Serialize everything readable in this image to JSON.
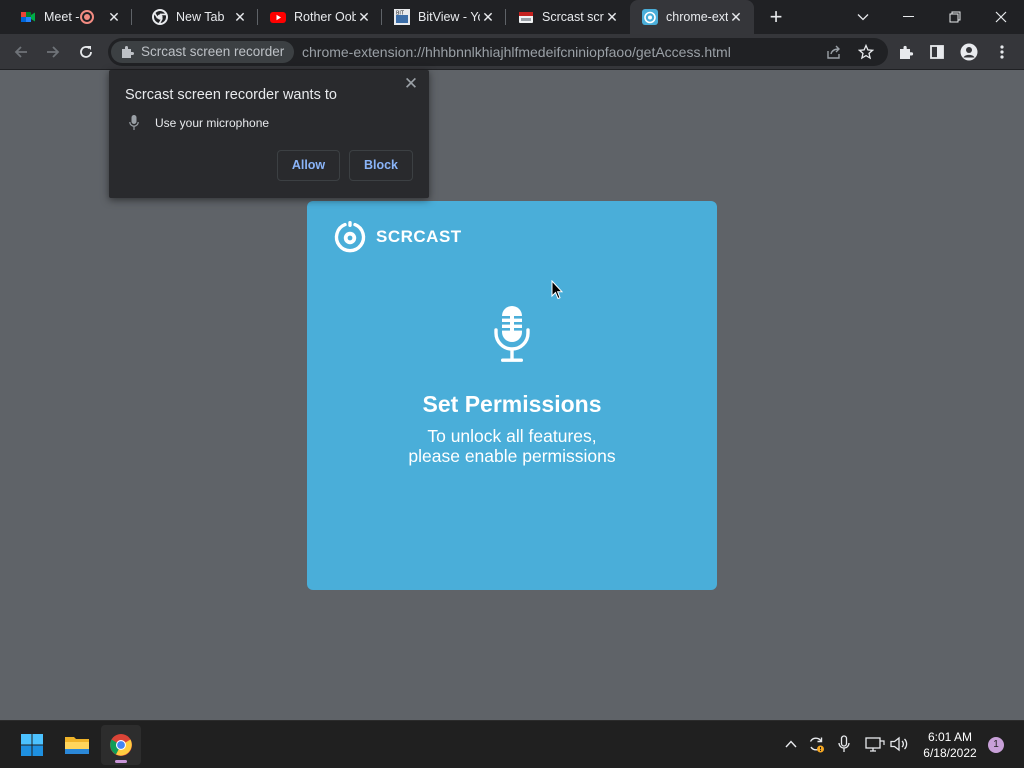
{
  "browser": {
    "tabs": [
      {
        "title": "Meet -",
        "favicon": "google-meet-icon"
      },
      {
        "title": "New Tab",
        "favicon": "chrome-icon"
      },
      {
        "title": "Rother Oob",
        "favicon": "youtube-icon"
      },
      {
        "title": "BitView - Yo",
        "favicon": "bitview-icon"
      },
      {
        "title": "Scrcast scre",
        "favicon": "scrcast-icon"
      },
      {
        "title": "chrome-ext",
        "favicon": "scrcast-icon",
        "active": true
      }
    ],
    "omnibox": {
      "chip_label": "Scrcast screen recorder",
      "url": "chrome-extension://hhhbnnlkhiajhlfmedeifcniniopfaoo/getAccess.html"
    }
  },
  "permission_prompt": {
    "title": "Scrcast screen recorder wants to",
    "permission": "Use your microphone",
    "allow_label": "Allow",
    "block_label": "Block"
  },
  "card": {
    "logo_text": "SCRCAST",
    "heading": "Set Permissions",
    "body": "To unlock all features, please enable permissions"
  },
  "taskbar": {
    "time": "6:01 AM",
    "date": "6/18/2022",
    "notification_count": "1"
  },
  "colors": {
    "card": "#4aaed9",
    "page_bg": "#5f6368",
    "link_blue": "#8ab4f8"
  }
}
